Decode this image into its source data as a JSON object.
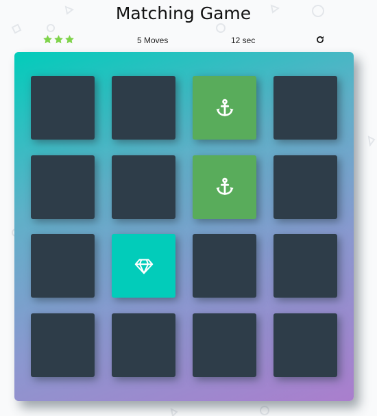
{
  "game": {
    "title": "Matching Game"
  },
  "score_panel": {
    "stars_total": 3,
    "stars_filled": 3,
    "star_icon": "star-icon",
    "star_color": "#7fd34a",
    "moves_text": "5 Moves",
    "timer_text": "12 sec",
    "restart_icon": "repeat-icon"
  },
  "colors": {
    "card_back": "#2e3d49",
    "card_match": "#59ac5b",
    "card_open": "#02ccba",
    "deck_gradient_start": "#02ccba",
    "deck_gradient_end": "#aa7ecd"
  },
  "deck": {
    "rows": 4,
    "cols": 4,
    "cards": [
      {
        "state": "closed",
        "icon": ""
      },
      {
        "state": "closed",
        "icon": ""
      },
      {
        "state": "match",
        "icon": "anchor-icon"
      },
      {
        "state": "closed",
        "icon": ""
      },
      {
        "state": "closed",
        "icon": ""
      },
      {
        "state": "closed",
        "icon": ""
      },
      {
        "state": "match",
        "icon": "anchor-icon"
      },
      {
        "state": "closed",
        "icon": ""
      },
      {
        "state": "closed",
        "icon": ""
      },
      {
        "state": "open",
        "icon": "diamond-icon"
      },
      {
        "state": "closed",
        "icon": ""
      },
      {
        "state": "closed",
        "icon": ""
      },
      {
        "state": "closed",
        "icon": ""
      },
      {
        "state": "closed",
        "icon": ""
      },
      {
        "state": "closed",
        "icon": ""
      },
      {
        "state": "closed",
        "icon": ""
      }
    ]
  }
}
